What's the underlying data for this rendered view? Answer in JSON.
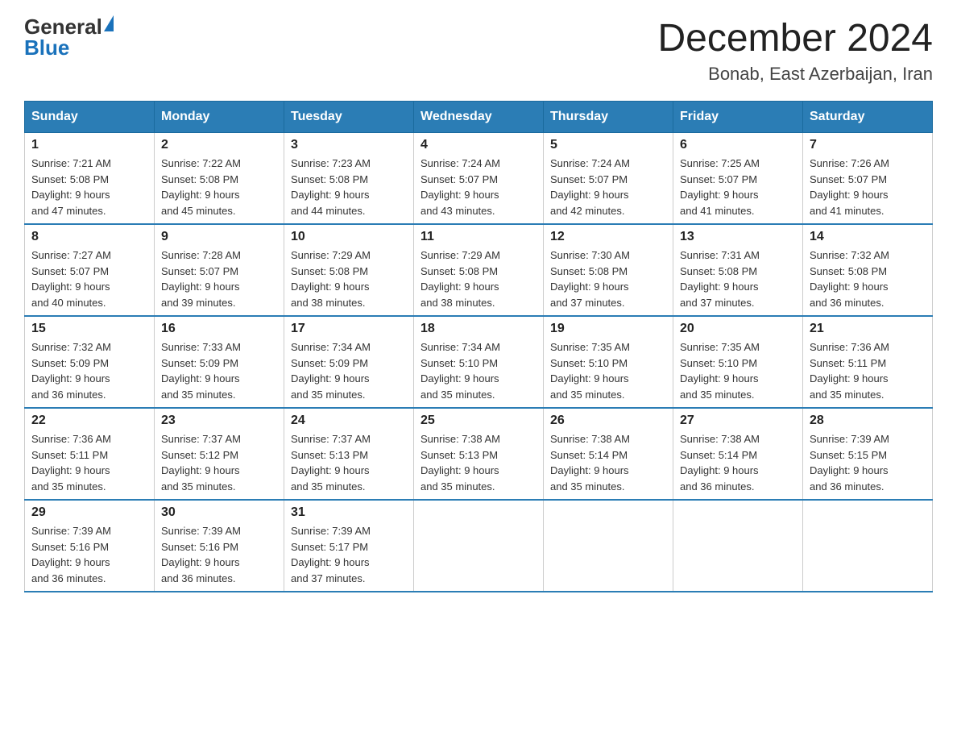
{
  "header": {
    "logo_general": "General",
    "logo_blue": "Blue",
    "month_title": "December 2024",
    "location": "Bonab, East Azerbaijan, Iran"
  },
  "columns": [
    "Sunday",
    "Monday",
    "Tuesday",
    "Wednesday",
    "Thursday",
    "Friday",
    "Saturday"
  ],
  "weeks": [
    [
      {
        "day": "1",
        "sunrise": "7:21 AM",
        "sunset": "5:08 PM",
        "daylight": "9 hours and 47 minutes."
      },
      {
        "day": "2",
        "sunrise": "7:22 AM",
        "sunset": "5:08 PM",
        "daylight": "9 hours and 45 minutes."
      },
      {
        "day": "3",
        "sunrise": "7:23 AM",
        "sunset": "5:08 PM",
        "daylight": "9 hours and 44 minutes."
      },
      {
        "day": "4",
        "sunrise": "7:24 AM",
        "sunset": "5:07 PM",
        "daylight": "9 hours and 43 minutes."
      },
      {
        "day": "5",
        "sunrise": "7:24 AM",
        "sunset": "5:07 PM",
        "daylight": "9 hours and 42 minutes."
      },
      {
        "day": "6",
        "sunrise": "7:25 AM",
        "sunset": "5:07 PM",
        "daylight": "9 hours and 41 minutes."
      },
      {
        "day": "7",
        "sunrise": "7:26 AM",
        "sunset": "5:07 PM",
        "daylight": "9 hours and 41 minutes."
      }
    ],
    [
      {
        "day": "8",
        "sunrise": "7:27 AM",
        "sunset": "5:07 PM",
        "daylight": "9 hours and 40 minutes."
      },
      {
        "day": "9",
        "sunrise": "7:28 AM",
        "sunset": "5:07 PM",
        "daylight": "9 hours and 39 minutes."
      },
      {
        "day": "10",
        "sunrise": "7:29 AM",
        "sunset": "5:08 PM",
        "daylight": "9 hours and 38 minutes."
      },
      {
        "day": "11",
        "sunrise": "7:29 AM",
        "sunset": "5:08 PM",
        "daylight": "9 hours and 38 minutes."
      },
      {
        "day": "12",
        "sunrise": "7:30 AM",
        "sunset": "5:08 PM",
        "daylight": "9 hours and 37 minutes."
      },
      {
        "day": "13",
        "sunrise": "7:31 AM",
        "sunset": "5:08 PM",
        "daylight": "9 hours and 37 minutes."
      },
      {
        "day": "14",
        "sunrise": "7:32 AM",
        "sunset": "5:08 PM",
        "daylight": "9 hours and 36 minutes."
      }
    ],
    [
      {
        "day": "15",
        "sunrise": "7:32 AM",
        "sunset": "5:09 PM",
        "daylight": "9 hours and 36 minutes."
      },
      {
        "day": "16",
        "sunrise": "7:33 AM",
        "sunset": "5:09 PM",
        "daylight": "9 hours and 35 minutes."
      },
      {
        "day": "17",
        "sunrise": "7:34 AM",
        "sunset": "5:09 PM",
        "daylight": "9 hours and 35 minutes."
      },
      {
        "day": "18",
        "sunrise": "7:34 AM",
        "sunset": "5:10 PM",
        "daylight": "9 hours and 35 minutes."
      },
      {
        "day": "19",
        "sunrise": "7:35 AM",
        "sunset": "5:10 PM",
        "daylight": "9 hours and 35 minutes."
      },
      {
        "day": "20",
        "sunrise": "7:35 AM",
        "sunset": "5:10 PM",
        "daylight": "9 hours and 35 minutes."
      },
      {
        "day": "21",
        "sunrise": "7:36 AM",
        "sunset": "5:11 PM",
        "daylight": "9 hours and 35 minutes."
      }
    ],
    [
      {
        "day": "22",
        "sunrise": "7:36 AM",
        "sunset": "5:11 PM",
        "daylight": "9 hours and 35 minutes."
      },
      {
        "day": "23",
        "sunrise": "7:37 AM",
        "sunset": "5:12 PM",
        "daylight": "9 hours and 35 minutes."
      },
      {
        "day": "24",
        "sunrise": "7:37 AM",
        "sunset": "5:13 PM",
        "daylight": "9 hours and 35 minutes."
      },
      {
        "day": "25",
        "sunrise": "7:38 AM",
        "sunset": "5:13 PM",
        "daylight": "9 hours and 35 minutes."
      },
      {
        "day": "26",
        "sunrise": "7:38 AM",
        "sunset": "5:14 PM",
        "daylight": "9 hours and 35 minutes."
      },
      {
        "day": "27",
        "sunrise": "7:38 AM",
        "sunset": "5:14 PM",
        "daylight": "9 hours and 36 minutes."
      },
      {
        "day": "28",
        "sunrise": "7:39 AM",
        "sunset": "5:15 PM",
        "daylight": "9 hours and 36 minutes."
      }
    ],
    [
      {
        "day": "29",
        "sunrise": "7:39 AM",
        "sunset": "5:16 PM",
        "daylight": "9 hours and 36 minutes."
      },
      {
        "day": "30",
        "sunrise": "7:39 AM",
        "sunset": "5:16 PM",
        "daylight": "9 hours and 36 minutes."
      },
      {
        "day": "31",
        "sunrise": "7:39 AM",
        "sunset": "5:17 PM",
        "daylight": "9 hours and 37 minutes."
      },
      null,
      null,
      null,
      null
    ]
  ]
}
